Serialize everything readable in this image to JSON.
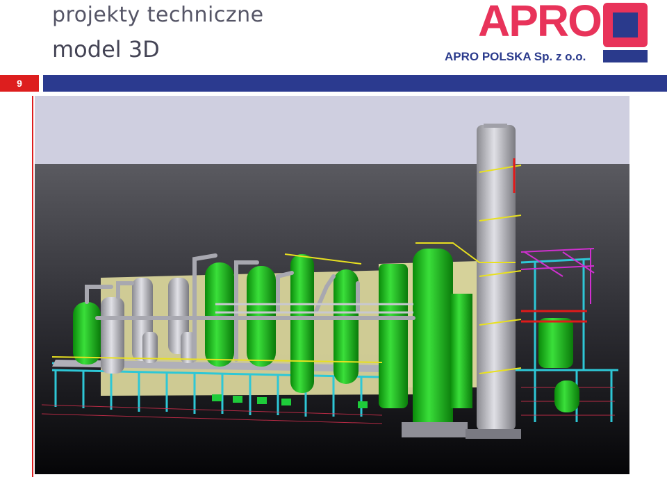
{
  "header": {
    "title_line1": "projekty techniczne",
    "title_line2": "model 3D"
  },
  "logo": {
    "wordmark": "APRO",
    "company": "APRO POLSKA Sp. z o.o.",
    "colors": {
      "red": "#e8335a",
      "blue": "#2a3a8c"
    }
  },
  "slide": {
    "number": "9"
  },
  "colors": {
    "bar_blue": "#2b3a8f",
    "accent_red": "#dd1e1e"
  },
  "viewport": {
    "icon": "plant-3d-model-icon"
  }
}
